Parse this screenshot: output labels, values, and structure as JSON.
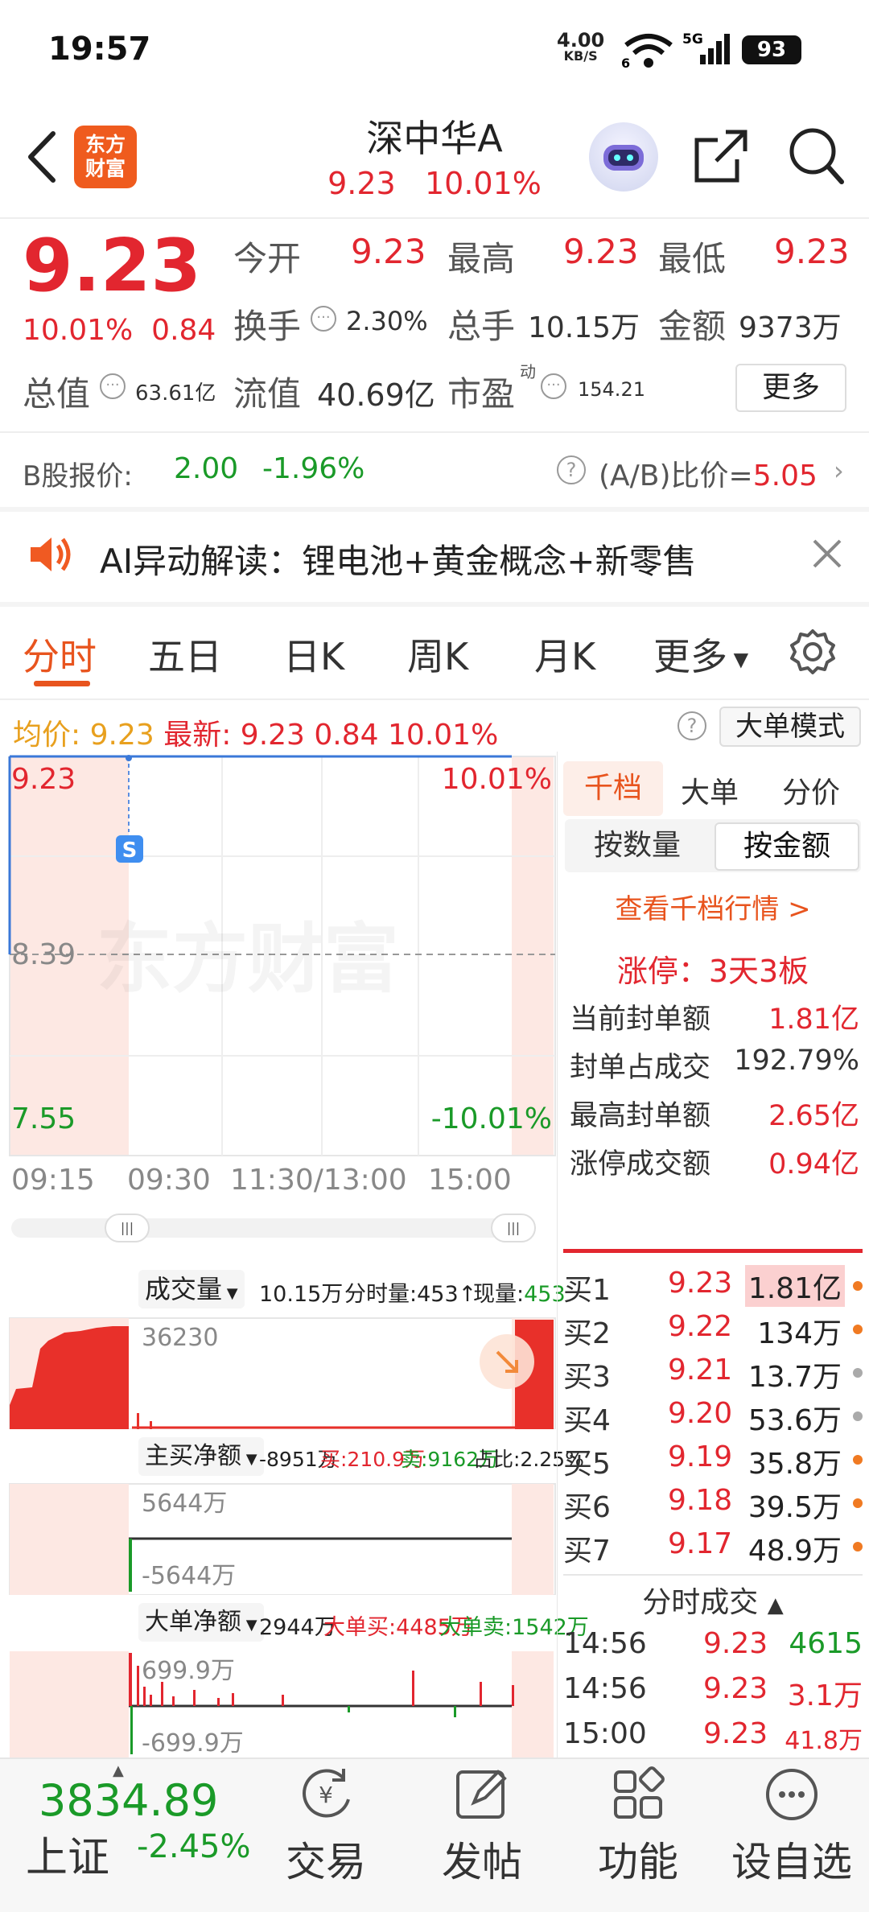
{
  "status": {
    "time": "19:57",
    "net_speed": "4.00",
    "net_unit": "KB/S",
    "signal": "5G",
    "battery": "93",
    "wifi_sub": "6"
  },
  "header": {
    "logo_line1": "东方",
    "logo_line2": "财富",
    "title": "深中华A",
    "price": "9.23",
    "pct": "10.01%"
  },
  "quote": {
    "price": "9.23",
    "pct": "10.01%",
    "chg": "0.84",
    "open_label": "今开",
    "open": "9.23",
    "high_label": "最高",
    "high": "9.23",
    "low_label": "最低",
    "low": "9.23",
    "turnover_label": "换手",
    "turnover": "2.30%",
    "vol_label": "总手",
    "vol": "10.15万",
    "amount_label": "金额",
    "amount": "9373万",
    "mcap_label": "总值",
    "mcap": "63.61亿",
    "float_label": "流值",
    "float": "40.69亿",
    "pe_label": "市盈",
    "pe_sup": "动",
    "pe": "154.21",
    "more": "更多"
  },
  "bshare": {
    "label": "B股报价:",
    "price": "2.00",
    "pct": "-1.96%",
    "ratio_label": "(A/B)比价=",
    "ratio": "5.05"
  },
  "ai": {
    "text": "AI异动解读：锂电池+黄金概念+新零售"
  },
  "tabs": {
    "t1": "分时",
    "t2": "五日",
    "t3": "日K",
    "t4": "周K",
    "t5": "月K",
    "t6": "更多"
  },
  "avgbar": {
    "avg_label": "均价:",
    "avg": "9.23",
    "last_label": "最新:",
    "last": "9.23",
    "chg": "0.84",
    "pct": "10.01%",
    "mode": "大单模式"
  },
  "chart": {
    "y_top": "9.23",
    "y_mid": "8.39",
    "y_bot": "7.55",
    "pct_top": "10.01%",
    "pct_bot": "-10.01%",
    "watermark": "东方财富",
    "s_marker": "S",
    "x1": "09:15",
    "x2": "09:30",
    "x3": "11:30/13:00",
    "x4": "15:00"
  },
  "vol": {
    "sel": "成交量",
    "total": "10.15万",
    "min_vol": "分时量:453↑",
    "cur_label": "现量:",
    "cur": "453",
    "axis": "36230"
  },
  "net": {
    "sel": "主买净额",
    "val": "-8951万",
    "buy": "买:210.9万",
    "sell": "卖:9162万",
    "ratio": "占比:2.25%",
    "top": "5644万",
    "bot": "-5644万"
  },
  "big": {
    "sel": "大单净额",
    "val": "2944万",
    "buy": "大单买:4485万",
    "sell": "大单卖:1542万",
    "top": "699.9万",
    "bot": "-699.9万"
  },
  "side": {
    "tab1": "千档",
    "tab2": "大单",
    "tab3": "分价",
    "sub1": "按数量",
    "sub2": "按金额",
    "link": "查看千档行情 >",
    "limit": "涨停：3天3板",
    "s1l": "当前封单额",
    "s1v": "1.81亿",
    "s2l": "封单占成交",
    "s2v": "192.79%",
    "s3l": "最高封单额",
    "s3v": "2.65亿",
    "s4l": "涨停成交额",
    "s4v": "0.94亿",
    "bids": [
      {
        "l": "买1",
        "p": "9.23",
        "v": "1.81亿"
      },
      {
        "l": "买2",
        "p": "9.22",
        "v": "134万"
      },
      {
        "l": "买3",
        "p": "9.21",
        "v": "13.7万"
      },
      {
        "l": "买4",
        "p": "9.20",
        "v": "53.6万"
      },
      {
        "l": "买5",
        "p": "9.19",
        "v": "35.8万"
      },
      {
        "l": "买6",
        "p": "9.18",
        "v": "39.5万"
      },
      {
        "l": "买7",
        "p": "9.17",
        "v": "48.9万"
      }
    ],
    "ticks_title": "分时成交",
    "ticks": [
      {
        "t": "14:56",
        "p": "9.23",
        "v": "4615"
      },
      {
        "t": "14:56",
        "p": "9.23",
        "v": "3.1万"
      },
      {
        "t": "15:00",
        "p": "9.23",
        "v": "41.8万"
      }
    ]
  },
  "bottom": {
    "index": "3834.89",
    "index_name": "上证",
    "index_pct": "-2.45%",
    "n1": "交易",
    "n2": "发帖",
    "n3": "功能",
    "n4": "设自选"
  }
}
